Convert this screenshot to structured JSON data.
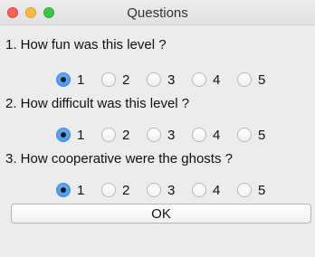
{
  "window": {
    "title": "Questions"
  },
  "questions": [
    {
      "text": "1. How fun was this level ?",
      "options": [
        "1",
        "2",
        "3",
        "4",
        "5"
      ],
      "selected": "1"
    },
    {
      "text": "2. How difficult was this level ?",
      "options": [
        "1",
        "2",
        "3",
        "4",
        "5"
      ],
      "selected": "1"
    },
    {
      "text": "3. How cooperative were the ghosts ?",
      "options": [
        "1",
        "2",
        "3",
        "4",
        "5"
      ],
      "selected": "1"
    }
  ],
  "ok_button": {
    "label": "OK"
  }
}
